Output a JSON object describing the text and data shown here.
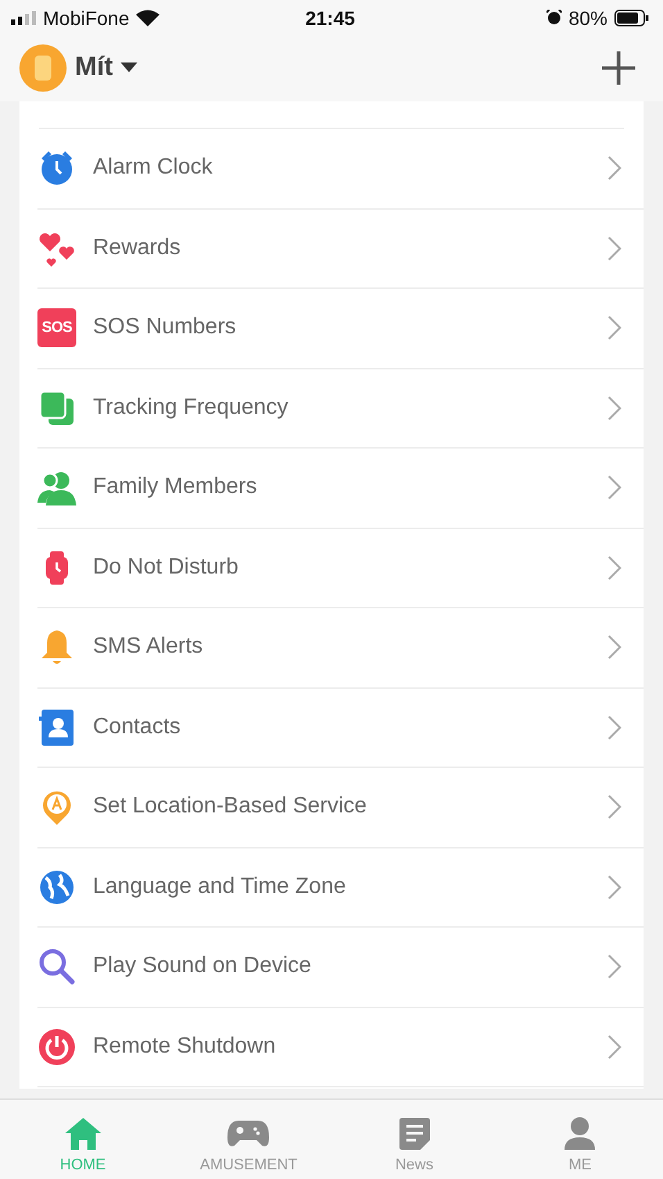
{
  "status_bar": {
    "carrier": "MobiFone",
    "time": "21:45",
    "battery": "80%"
  },
  "header": {
    "device_name": "Mít"
  },
  "settings": [
    {
      "label": "Alarm Clock",
      "kind": "alarm"
    },
    {
      "label": "Rewards",
      "kind": "hearts"
    },
    {
      "label": "SOS Numbers",
      "kind": "sos",
      "badge": "SOS"
    },
    {
      "label": "Tracking Frequency",
      "kind": "squares"
    },
    {
      "label": "Family Members",
      "kind": "people"
    },
    {
      "label": "Do Not Disturb",
      "kind": "watch"
    },
    {
      "label": "SMS Alerts",
      "kind": "bell"
    },
    {
      "label": "Contacts",
      "kind": "contacts"
    },
    {
      "label": "Set Location-Based Service",
      "kind": "pin"
    },
    {
      "label": "Language and Time Zone",
      "kind": "globe"
    },
    {
      "label": "Play Sound on Device",
      "kind": "search"
    },
    {
      "label": "Remote Shutdown",
      "kind": "power"
    }
  ],
  "tab_bar": [
    {
      "label": "HOME",
      "kind": "home",
      "selected": true
    },
    {
      "label": "AMUSEMENT",
      "kind": "gamepad",
      "selected": false
    },
    {
      "label": "News",
      "kind": "news",
      "selected": false
    },
    {
      "label": "ME",
      "kind": "person",
      "selected": false
    }
  ]
}
